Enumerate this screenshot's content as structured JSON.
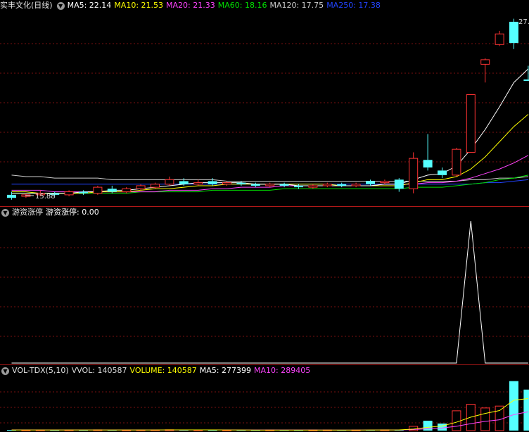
{
  "price_panel": {
    "title": "实丰文化(日线)",
    "indicators": [
      {
        "label": "MA5: 22.14",
        "color": "#ffffff"
      },
      {
        "label": "MA10: 21.53",
        "color": "#ffff00"
      },
      {
        "label": "MA20: 21.33",
        "color": "#ff44ff"
      },
      {
        "label": "MA60: 18.16",
        "color": "#00e000"
      },
      {
        "label": "MA120: 17.75",
        "color": "#cccccc"
      },
      {
        "label": "MA250: 17.38",
        "color": "#2244ff"
      }
    ],
    "low_marker": "15.88",
    "high_marker": "27."
  },
  "indicator_panel": {
    "name": "游资涨停",
    "value_label": "游资涨停: 0.00"
  },
  "volume_panel": {
    "name": "VOL-TDX(5,10)",
    "items": [
      {
        "label": "VVOL: 140587",
        "color": "#dddddd"
      },
      {
        "label": "VOLUME: 140587",
        "color": "#ffff00"
      },
      {
        "label": "MA5: 277399",
        "color": "#ffffff"
      },
      {
        "label": "MA10: 289405",
        "color": "#ff44ff"
      }
    ]
  },
  "chart_data": {
    "type": "candlestick",
    "candles": [
      {
        "o": 16.2,
        "c": 16.0,
        "h": 16.4,
        "l": 15.88
      },
      {
        "o": 16.1,
        "c": 16.2,
        "h": 16.3,
        "l": 16.0
      },
      {
        "o": 16.2,
        "c": 16.3,
        "h": 16.5,
        "l": 16.1
      },
      {
        "o": 16.3,
        "c": 16.2,
        "h": 16.4,
        "l": 16.1
      },
      {
        "o": 16.2,
        "c": 16.4,
        "h": 16.5,
        "l": 16.1
      },
      {
        "o": 16.4,
        "c": 16.3,
        "h": 16.5,
        "l": 16.2
      },
      {
        "o": 16.3,
        "c": 16.7,
        "h": 16.8,
        "l": 16.2
      },
      {
        "o": 16.6,
        "c": 16.4,
        "h": 16.8,
        "l": 16.3
      },
      {
        "o": 16.4,
        "c": 16.6,
        "h": 16.7,
        "l": 16.3
      },
      {
        "o": 16.6,
        "c": 16.8,
        "h": 16.9,
        "l": 16.5
      },
      {
        "o": 16.7,
        "c": 16.9,
        "h": 17.0,
        "l": 16.6
      },
      {
        "o": 16.9,
        "c": 17.2,
        "h": 17.4,
        "l": 16.8
      },
      {
        "o": 17.1,
        "c": 16.9,
        "h": 17.3,
        "l": 16.8
      },
      {
        "o": 16.9,
        "c": 17.0,
        "h": 17.2,
        "l": 16.8
      },
      {
        "o": 17.1,
        "c": 16.9,
        "h": 17.3,
        "l": 16.8
      },
      {
        "o": 16.9,
        "c": 17.0,
        "h": 17.1,
        "l": 16.8
      },
      {
        "o": 17.0,
        "c": 16.9,
        "h": 17.1,
        "l": 16.8
      },
      {
        "o": 16.9,
        "c": 16.8,
        "h": 17.0,
        "l": 16.7
      },
      {
        "o": 16.8,
        "c": 16.9,
        "h": 17.0,
        "l": 16.7
      },
      {
        "o": 16.9,
        "c": 16.8,
        "h": 17.0,
        "l": 16.7
      },
      {
        "o": 16.8,
        "c": 16.7,
        "h": 16.9,
        "l": 16.6
      },
      {
        "o": 16.7,
        "c": 16.8,
        "h": 16.9,
        "l": 16.6
      },
      {
        "o": 16.8,
        "c": 16.9,
        "h": 17.0,
        "l": 16.7
      },
      {
        "o": 16.9,
        "c": 16.8,
        "h": 17.0,
        "l": 16.7
      },
      {
        "o": 16.8,
        "c": 16.9,
        "h": 17.0,
        "l": 16.7
      },
      {
        "o": 17.1,
        "c": 16.9,
        "h": 17.2,
        "l": 16.8
      },
      {
        "o": 17.0,
        "c": 17.1,
        "h": 17.2,
        "l": 16.9
      },
      {
        "o": 17.2,
        "c": 16.6,
        "h": 17.3,
        "l": 16.4
      },
      {
        "o": 16.6,
        "c": 18.6,
        "h": 19.0,
        "l": 16.3
      },
      {
        "o": 18.5,
        "c": 18.0,
        "h": 20.2,
        "l": 17.8
      },
      {
        "o": 17.8,
        "c": 17.5,
        "h": 18.0,
        "l": 17.3
      },
      {
        "o": 17.5,
        "c": 19.2,
        "h": 19.3,
        "l": 17.4
      },
      {
        "o": 19.0,
        "c": 22.8,
        "h": 22.8,
        "l": 19.0
      },
      {
        "o": 24.8,
        "c": 25.1,
        "h": 25.2,
        "l": 23.6
      },
      {
        "o": 26.1,
        "c": 26.8,
        "h": 27.0,
        "l": 26.0
      },
      {
        "o": 27.6,
        "c": 26.2,
        "h": 27.8,
        "l": 25.8
      },
      {
        "o": 23.8,
        "c": 23.7,
        "h": 24.7,
        "l": 23.7
      }
    ],
    "ma5": [
      16.3,
      16.3,
      16.3,
      16.3,
      16.3,
      16.4,
      16.4,
      16.5,
      16.5,
      16.6,
      16.7,
      16.8,
      16.9,
      17.0,
      17.0,
      17.0,
      17.0,
      16.9,
      16.9,
      16.9,
      16.8,
      16.8,
      16.8,
      16.8,
      16.8,
      16.8,
      16.9,
      16.9,
      17.2,
      17.5,
      17.6,
      18.1,
      19.2,
      20.5,
      22.0,
      23.6,
      24.5
    ],
    "ma10": [
      16.4,
      16.4,
      16.3,
      16.3,
      16.3,
      16.3,
      16.4,
      16.4,
      16.4,
      16.5,
      16.6,
      16.6,
      16.7,
      16.8,
      16.8,
      16.9,
      16.9,
      16.9,
      16.9,
      16.9,
      16.9,
      16.9,
      16.9,
      16.8,
      16.8,
      16.8,
      16.8,
      16.8,
      17.0,
      17.2,
      17.2,
      17.4,
      17.9,
      18.7,
      19.7,
      20.7,
      21.5
    ],
    "ma20": [
      16.5,
      16.5,
      16.5,
      16.4,
      16.4,
      16.4,
      16.4,
      16.4,
      16.4,
      16.4,
      16.4,
      16.5,
      16.5,
      16.5,
      16.6,
      16.6,
      16.7,
      16.7,
      16.7,
      16.8,
      16.8,
      16.8,
      16.8,
      16.8,
      16.8,
      16.8,
      16.9,
      16.9,
      16.9,
      17.0,
      17.0,
      17.1,
      17.3,
      17.6,
      17.9,
      18.3,
      18.8
    ],
    "ma60": [
      16.3,
      16.3,
      16.3,
      16.3,
      16.3,
      16.3,
      16.3,
      16.3,
      16.3,
      16.4,
      16.4,
      16.4,
      16.4,
      16.4,
      16.5,
      16.5,
      16.5,
      16.5,
      16.5,
      16.6,
      16.6,
      16.6,
      16.6,
      16.6,
      16.6,
      16.6,
      16.6,
      16.6,
      16.7,
      16.7,
      16.7,
      16.8,
      16.9,
      17.0,
      17.2,
      17.3,
      17.5
    ],
    "ma120": [
      17.5,
      17.4,
      17.4,
      17.3,
      17.3,
      17.3,
      17.3,
      17.2,
      17.2,
      17.2,
      17.2,
      17.2,
      17.2,
      17.2,
      17.2,
      17.1,
      17.1,
      17.1,
      17.1,
      17.1,
      17.1,
      17.1,
      17.1,
      17.1,
      17.1,
      17.1,
      17.1,
      17.1,
      17.1,
      17.1,
      17.1,
      17.1,
      17.2,
      17.2,
      17.3,
      17.3,
      17.4
    ],
    "ma250": [
      16.9,
      16.9,
      16.9,
      16.9,
      16.9,
      16.9,
      16.9,
      16.9,
      16.9,
      16.9,
      16.9,
      16.9,
      16.9,
      16.9,
      16.9,
      16.9,
      16.9,
      16.9,
      16.9,
      16.9,
      16.9,
      16.9,
      16.9,
      16.9,
      16.9,
      16.9,
      16.9,
      16.9,
      16.9,
      16.9,
      16.9,
      16.9,
      16.9,
      17.0,
      17.0,
      17.1,
      17.2
    ],
    "signal": [
      0,
      0,
      0,
      0,
      0,
      0,
      0,
      0,
      0,
      0,
      0,
      0,
      0,
      0,
      0,
      0,
      0,
      0,
      0,
      0,
      0,
      0,
      0,
      0,
      0,
      0,
      0,
      0,
      0,
      0,
      0,
      0,
      1,
      0,
      0,
      0,
      0
    ],
    "volume": [
      15000,
      12000,
      13000,
      11000,
      14000,
      12000,
      16000,
      13000,
      12000,
      14000,
      15000,
      18000,
      14000,
      13000,
      12000,
      11000,
      12000,
      11000,
      13000,
      12000,
      11000,
      12000,
      13000,
      12000,
      12000,
      14000,
      16000,
      20000,
      90000,
      210000,
      150000,
      420000,
      560000,
      480000,
      520000,
      1050000,
      870000
    ],
    "vol_ma5": [
      14000,
      14000,
      13500,
      13000,
      13000,
      13000,
      13500,
      13500,
      14000,
      14000,
      14000,
      15000,
      15000,
      15000,
      14500,
      13500,
      12500,
      12000,
      12000,
      11500,
      12000,
      12000,
      12000,
      12000,
      12000,
      12500,
      13500,
      15000,
      32000,
      70000,
      97000,
      178000,
      286000,
      364000,
      426000,
      646000,
      680000
    ],
    "vol_ma10": [
      14500,
      14500,
      14000,
      14000,
      13500,
      13500,
      13500,
      13500,
      13500,
      13500,
      14000,
      14000,
      14000,
      14500,
      14500,
      14500,
      14000,
      14000,
      13500,
      13000,
      12500,
      12500,
      12000,
      12000,
      12000,
      12500,
      12500,
      13500,
      22000,
      40000,
      55000,
      92000,
      148000,
      196000,
      230000,
      340000,
      400000
    ],
    "price_range": [
      15.5,
      28.2
    ],
    "signal_range": [
      0,
      1
    ],
    "volume_range": [
      0,
      1150000
    ]
  }
}
